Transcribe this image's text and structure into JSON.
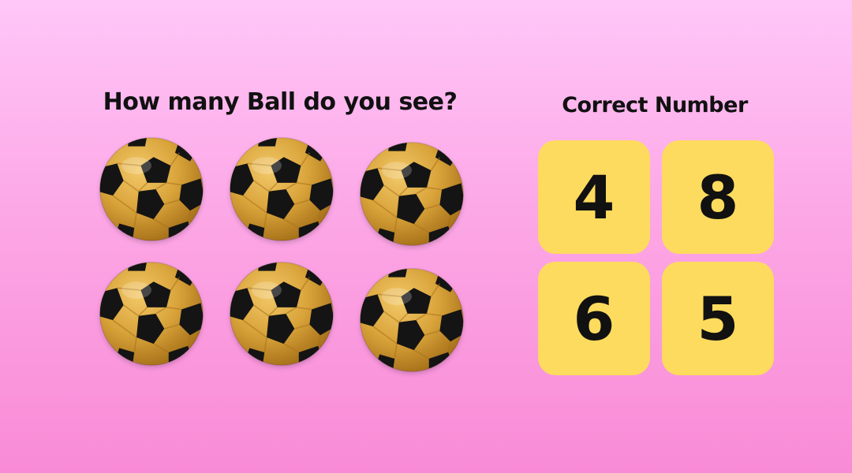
{
  "question": "How many Ball do you see?",
  "answers_title": "Correct Number",
  "ball_icon": "soccer-ball-icon",
  "ball_colors": {
    "panel": "#d9a33a",
    "panel_shadow": "#a8721a",
    "patch": "#141414"
  },
  "ball_count_shown": 6,
  "options": [
    "4",
    "8",
    "6",
    "5"
  ],
  "colors": {
    "background_top": "#ffc7f8",
    "background_bottom": "#f98bd6",
    "option_tile": "#fddb5e",
    "text": "#111111"
  }
}
